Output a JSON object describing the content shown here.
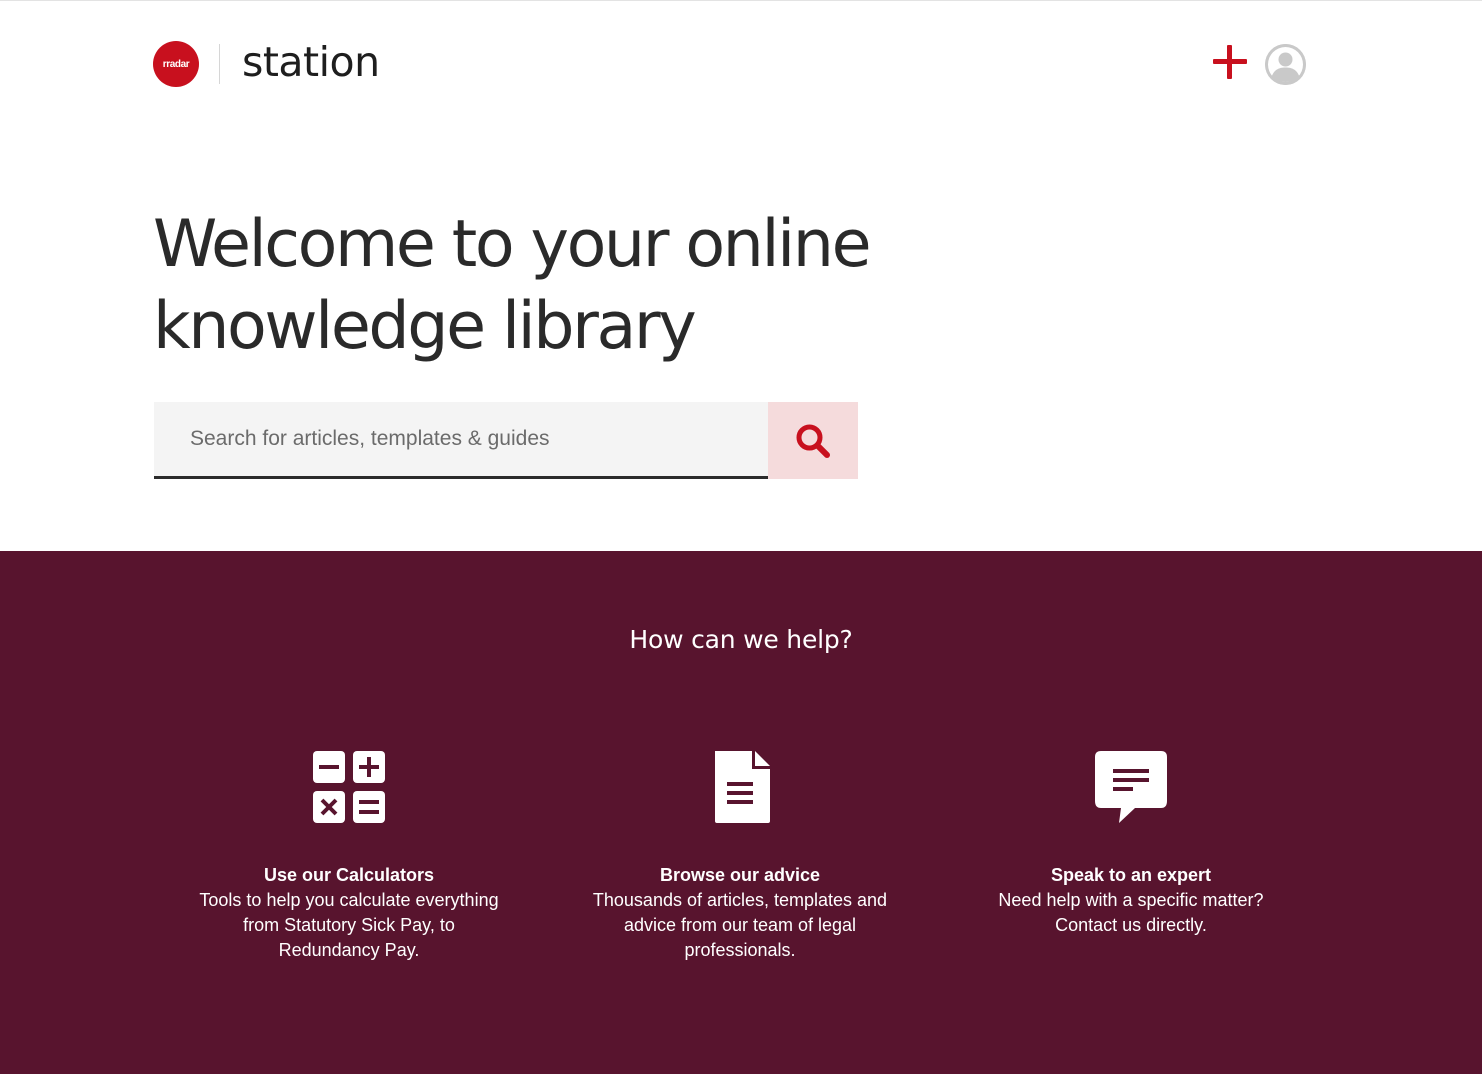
{
  "brand": {
    "logo_text": "rradar",
    "name": "station"
  },
  "header": {
    "icons": [
      "plus-icon",
      "user-avatar-icon"
    ]
  },
  "hero": {
    "title_line1": "Welcome to your online",
    "title_line2": "knowledge library"
  },
  "search": {
    "placeholder": "Search for articles, templates & guides",
    "value": "",
    "button_icon": "search-icon"
  },
  "help": {
    "title": "How can we help?",
    "cards": [
      {
        "icon": "calculator-icon",
        "title": "Use our Calculators",
        "description": "Tools to help you calculate everything from Statutory Sick Pay, to Redundancy Pay."
      },
      {
        "icon": "document-icon",
        "title": "Browse our advice",
        "description": "Thousands of articles, templates and advice from our team of legal professionals."
      },
      {
        "icon": "chat-message-icon",
        "title": "Speak to an expert",
        "description": "Need help with a specific matter? Contact us directly."
      }
    ]
  },
  "colors": {
    "brand_red": "#c8101e",
    "section_background": "#58142e",
    "search_button_background": "#f5dbdc",
    "search_field_background": "#f4f4f4"
  }
}
